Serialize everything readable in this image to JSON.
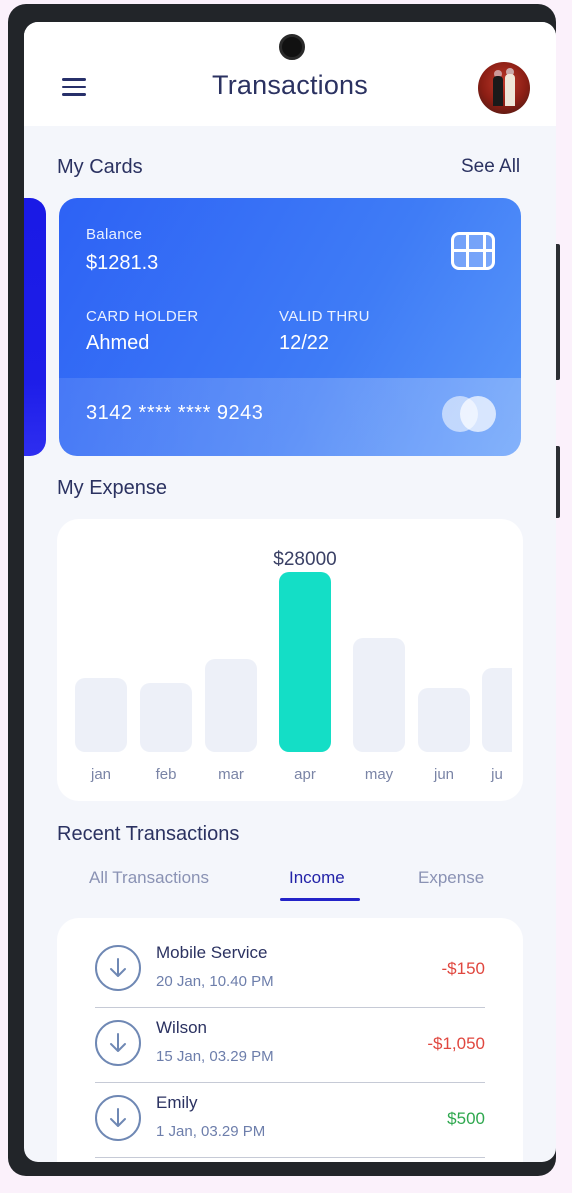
{
  "header": {
    "title": "Transactions"
  },
  "cards_section": {
    "title": "My Cards",
    "see_all": "See All"
  },
  "card": {
    "balance_label": "Balance",
    "balance_value": "$1281.3",
    "holder_label": "CARD HOLDER",
    "holder_value": "Ahmed",
    "valid_label": "VALID THRU",
    "valid_value": "12/22",
    "number": "3142 **** **** 9243"
  },
  "expense_section": {
    "title": "My Expense"
  },
  "chart_data": {
    "type": "bar",
    "categories": [
      "jan",
      "feb",
      "mar",
      "apr",
      "may",
      "jun",
      "ju"
    ],
    "values": [
      11500,
      10700,
      14500,
      28000,
      17700,
      9900,
      13000
    ],
    "highlight_index": 3,
    "highlight_label": "$28000",
    "colors": {
      "bar": "#edf0f8",
      "highlight": "#14dec6"
    }
  },
  "recent": {
    "title": "Recent Transactions",
    "tabs": [
      {
        "label": "All Transactions"
      },
      {
        "label": "Income"
      },
      {
        "label": "Expense"
      }
    ],
    "active_tab": "Income",
    "items": [
      {
        "name": "Mobile Service",
        "date": "20 Jan, 10.40 PM",
        "amount": "-$150",
        "color": "#e0473f"
      },
      {
        "name": "Wilson",
        "date": "15 Jan, 03.29 PM",
        "amount": "-$1,050",
        "color": "#e0473f"
      },
      {
        "name": "Emily",
        "date": "1 Jan, 03.29 PM",
        "amount": "$500",
        "color": "#2fa84f"
      }
    ]
  }
}
